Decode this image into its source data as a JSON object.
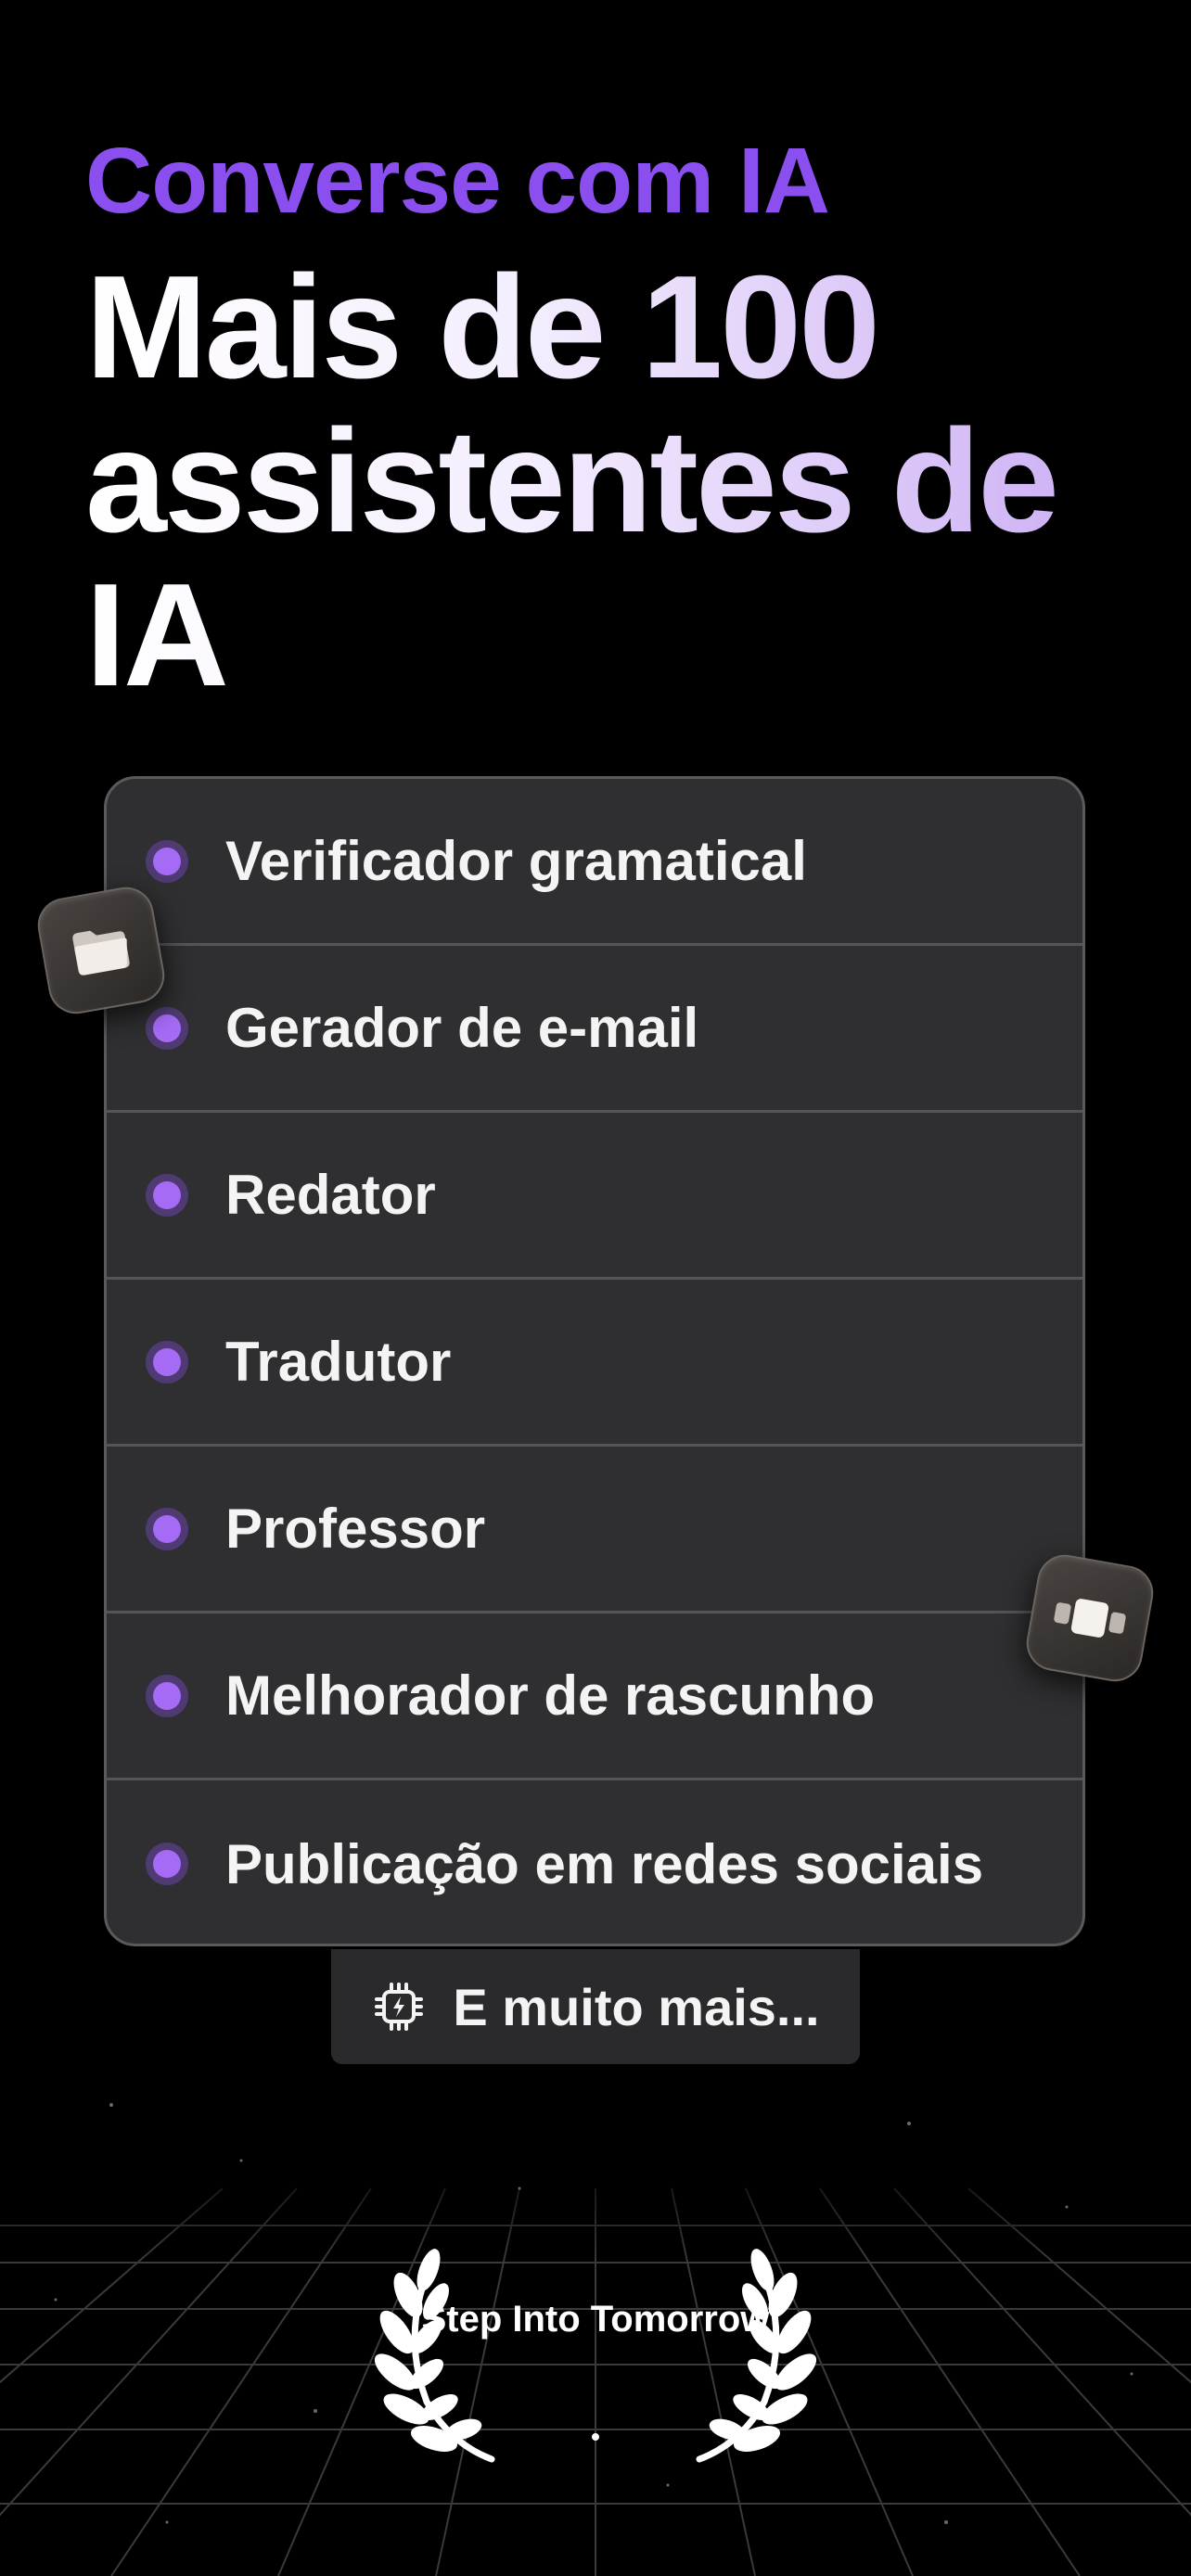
{
  "header": {
    "eyebrow": "Converse com IA",
    "headline": "Mais de 100 assistentes de IA"
  },
  "assistants": [
    {
      "label": "Verificador gramatical"
    },
    {
      "label": "Gerador de e-mail"
    },
    {
      "label": "Redator"
    },
    {
      "label": "Tradutor"
    },
    {
      "label": "Professor"
    },
    {
      "label": "Melhorador de rascunho"
    },
    {
      "label": "Publicação em redes sociais"
    }
  ],
  "more": {
    "label": "E muito mais...",
    "icon": "chip-lightning-icon"
  },
  "award": {
    "text": "Step Into Tomorrow"
  },
  "icons": {
    "floating_left": "folder-icon",
    "floating_right": "carousel-icon"
  },
  "colors": {
    "background": "#000000",
    "accent": "#8b4ff0",
    "card": "#2f2f31",
    "bullet": "#a56bf5"
  }
}
